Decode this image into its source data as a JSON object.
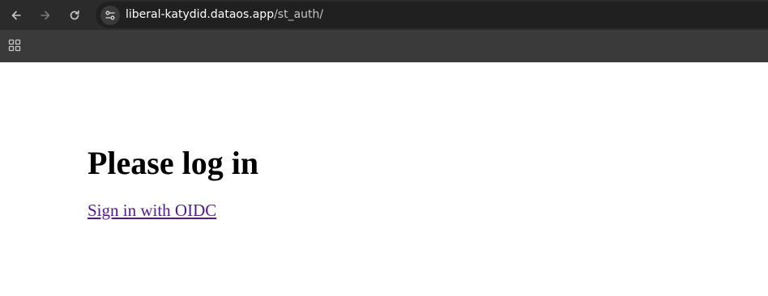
{
  "browser": {
    "url_host": "liberal-katydid.dataos.app",
    "url_path": "/st_auth/",
    "icons": {
      "back": "arrow-left-icon",
      "forward": "arrow-right-icon",
      "reload": "reload-icon",
      "site_info": "tune-icon",
      "apps": "apps-grid-icon"
    },
    "colors": {
      "toolbar": "#2b2b2b",
      "bookmarks_bar": "#3a3a3a",
      "omnibox": "#202020"
    }
  },
  "page": {
    "heading": "Please log in",
    "sign_in_link": "Sign in with OIDC",
    "link_color": "#551a8b"
  }
}
